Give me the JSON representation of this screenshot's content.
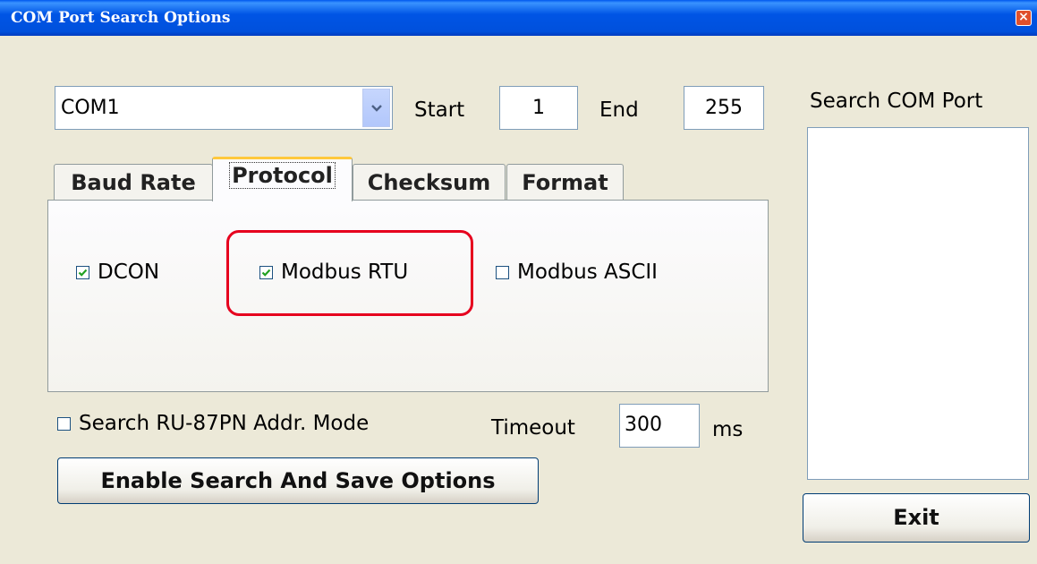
{
  "window": {
    "title": "COM Port Search Options",
    "close_glyph": "×"
  },
  "port_select": {
    "value": "COM1"
  },
  "range": {
    "start_label": "Start",
    "start_value": "1",
    "end_label": "End",
    "end_value": "255"
  },
  "tabs": [
    {
      "label": "Baud Rate",
      "active": false
    },
    {
      "label": "Protocol",
      "active": true
    },
    {
      "label": "Checksum",
      "active": false
    },
    {
      "label": "Format",
      "active": false
    }
  ],
  "protocol": {
    "dcon": {
      "label": "DCON",
      "checked": true
    },
    "modbus_rtu": {
      "label": "Modbus RTU",
      "checked": true
    },
    "modbus_ascii": {
      "label": "Modbus ASCII",
      "checked": false
    }
  },
  "ru87pn": {
    "label": "Search RU-87PN Addr. Mode",
    "checked": false
  },
  "timeout": {
    "label": "Timeout",
    "value": "300",
    "unit": "ms"
  },
  "enable_button": {
    "label": "Enable Search And Save  Options"
  },
  "search_panel": {
    "label": "Search COM Port"
  },
  "exit_button": {
    "label": "Exit"
  },
  "colors": {
    "titlebar": "#0055e5",
    "dialog": "#ece9d8",
    "highlight": "#e6001e",
    "tab_hot": "#ffc83c",
    "check": "#21a121"
  },
  "icons": [
    "close-icon",
    "chevron-down-icon",
    "checkmark-icon"
  ]
}
